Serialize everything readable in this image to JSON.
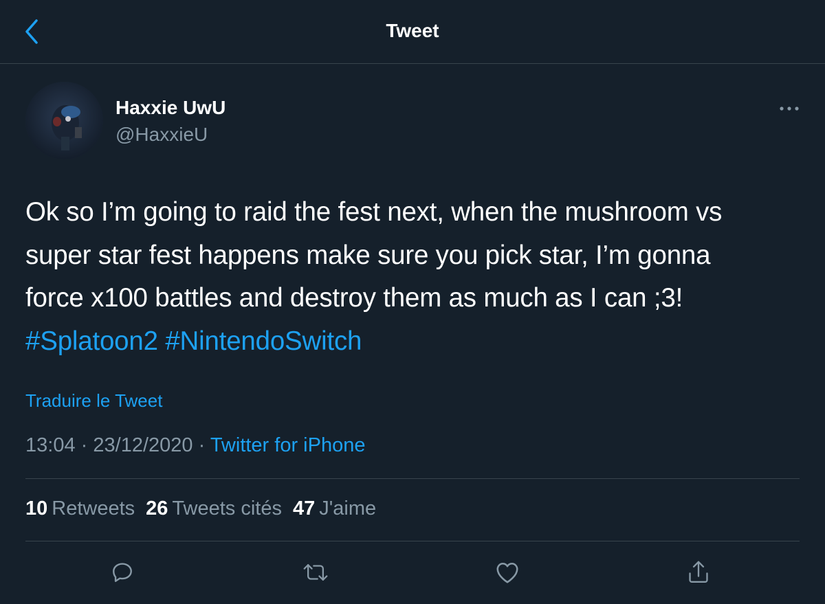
{
  "header": {
    "title": "Tweet"
  },
  "author": {
    "display_name": "Haxxie UwU",
    "handle": "@HaxxieU"
  },
  "tweet": {
    "lines": [
      "Ok so I’m going to raid the fest next, when the mushroom vs",
      "super star fest happens make sure you pick star, I’m gonna",
      "force x100 battles and destroy them as much as I can ;3!"
    ],
    "hashtags": [
      "#Splatoon2",
      "#NintendoSwitch"
    ],
    "translate_label": "Traduire le Tweet",
    "time": "13:04",
    "date": "23/12/2020",
    "separator": "·",
    "source": "Twitter for iPhone"
  },
  "stats": {
    "retweets": {
      "count": "10",
      "label": "Retweets"
    },
    "quotes": {
      "count": "26",
      "label": "Tweets cités"
    },
    "likes": {
      "count": "47",
      "label": "J'aime"
    }
  },
  "actions": [
    "reply-icon",
    "retweet-icon",
    "like-icon",
    "share-icon"
  ],
  "colors": {
    "background": "#15202b",
    "accent": "#1da1f2",
    "secondary_text": "#8899a6",
    "divider": "#38444d"
  }
}
